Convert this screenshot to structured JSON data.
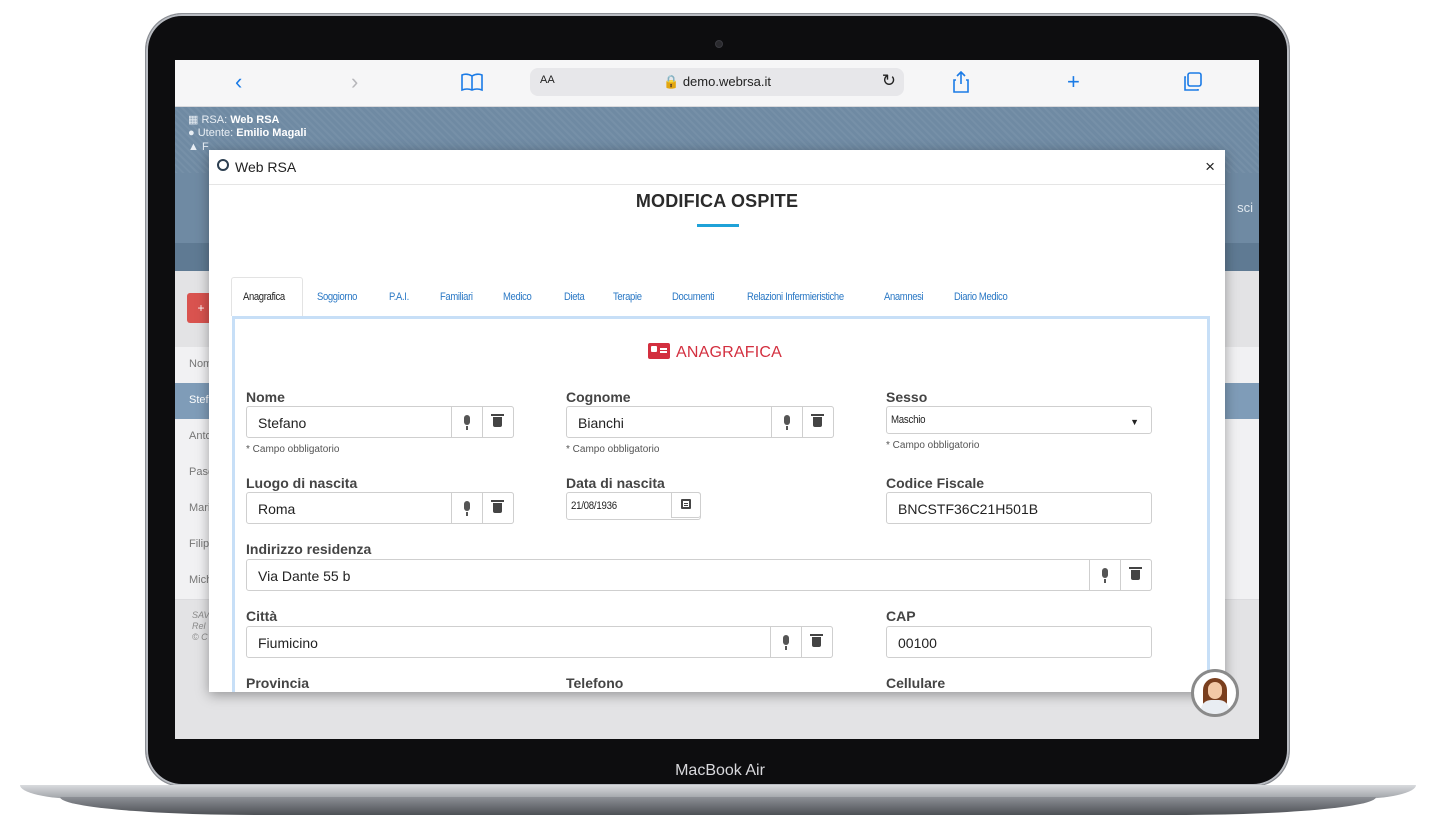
{
  "device": {
    "label": "MacBook Air"
  },
  "browser": {
    "back_icon": "‹",
    "forward_icon": "›",
    "bookmarks_icon": "book-icon",
    "text_size": "AA",
    "url": "🔒 demo.webrsa.it",
    "reload_icon": "↻",
    "share_icon": "share-icon",
    "new_tab_icon": "+",
    "tabs_icon": "tabs-icon",
    "accent_color": "#1b7be6"
  },
  "app": {
    "rsa_label": "RSA: ",
    "rsa_value": "Web RSA",
    "user_label": "Utente: ",
    "user_value": "Emilio Magali",
    "third_label": "F",
    "right_partial": "sci",
    "list_rows": [
      "Nom",
      "Stef",
      "Anto",
      "Pasc",
      "Mari",
      "Filip",
      "Mich"
    ],
    "footer_lines": [
      "SAV",
      "Rel",
      "© C"
    ],
    "header_color": "#6f8aa3"
  },
  "modal": {
    "brand": "Web RSA",
    "close": "×",
    "title": "MODIFICA OSPITE",
    "tabs": [
      "Anagrafica",
      "Soggiorno",
      "P.A.I.",
      "Familiari",
      "Medico",
      "Dieta",
      "Terapie",
      "Documenti",
      "Relazioni Infermieristiche",
      "Anamnesi",
      "Diario Medico"
    ],
    "active_tab": "Anagrafica",
    "section_title": "ANAGRAFICA",
    "section_color": "#d32f3f",
    "required_note": "* Campo obbligatorio",
    "fields": {
      "nome": {
        "label": "Nome",
        "value": "Stefano"
      },
      "cognome": {
        "label": "Cognome",
        "value": "Bianchi"
      },
      "sesso": {
        "label": "Sesso",
        "value": "Maschio"
      },
      "luogo_nascita": {
        "label": "Luogo di nascita",
        "value": "Roma"
      },
      "data_nascita": {
        "label": "Data di nascita",
        "value": "21/08/1936"
      },
      "codice_fiscale": {
        "label": "Codice Fiscale",
        "value": "BNCSTF36C21H501B"
      },
      "indirizzo": {
        "label": "Indirizzo residenza",
        "value": "Via Dante 55 b"
      },
      "citta": {
        "label": "Città",
        "value": "Fiumicino"
      },
      "cap": {
        "label": "CAP",
        "value": "00100"
      },
      "provincia": {
        "label": "Provincia"
      },
      "telefono": {
        "label": "Telefono"
      },
      "cellulare": {
        "label": "Cellulare"
      }
    }
  }
}
